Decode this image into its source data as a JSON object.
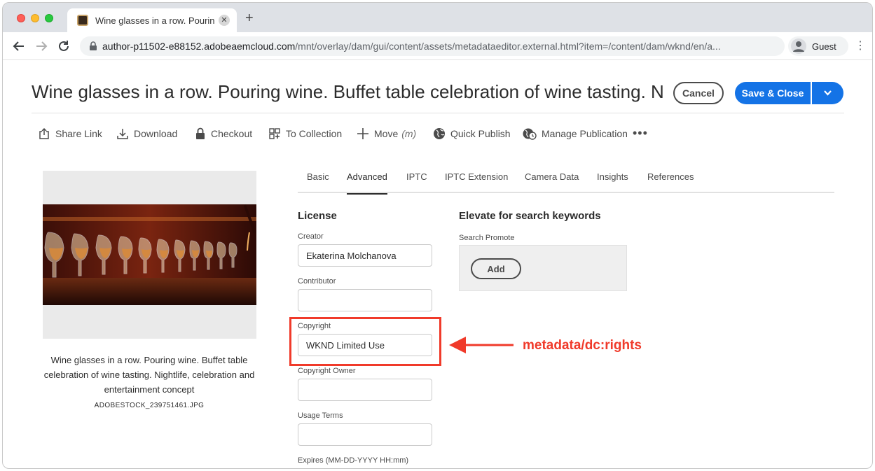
{
  "browser": {
    "tab_title": "Wine glasses in a row. Pouring",
    "url_host": "author-p11502-e88152.adobeaemcloud.com",
    "url_path": "/mnt/overlay/dam/gui/content/assets/metadataeditor.external.html?item=/content/dam/wknd/en/a...",
    "profile_label": "Guest"
  },
  "header": {
    "title": "Wine glasses in a row. Pouring wine. Buffet table celebration of wine tasting. Nightlife, celebration and entertainment concept",
    "cancel_label": "Cancel",
    "save_label": "Save & Close"
  },
  "actions": {
    "share_link": "Share Link",
    "download": "Download",
    "checkout": "Checkout",
    "to_collection": "To Collection",
    "move": "Move",
    "move_shortcut": "(m)",
    "quick_publish": "Quick Publish",
    "manage_publication": "Manage Publication",
    "more": "•••"
  },
  "asset": {
    "caption": "Wine glasses in a row. Pouring wine. Buffet table celebration of wine tasting. Nightlife, celebration and entertainment concept",
    "filename": "ADOBESTOCK_239751461.JPG"
  },
  "tabs": {
    "basic": "Basic",
    "advanced": "Advanced",
    "iptc": "IPTC",
    "iptc_extension": "IPTC Extension",
    "camera_data": "Camera Data",
    "insights": "Insights",
    "references": "References"
  },
  "license": {
    "heading": "License",
    "creator_label": "Creator",
    "creator_value": "Ekaterina Molchanova",
    "contributor_label": "Contributor",
    "contributor_value": "",
    "copyright_label": "Copyright",
    "copyright_value": "WKND Limited Use",
    "copyright_owner_label": "Copyright Owner",
    "copyright_owner_value": "",
    "usage_terms_label": "Usage Terms",
    "usage_terms_value": "",
    "expires_label": "Expires (MM-DD-YYYY HH:mm)"
  },
  "search": {
    "heading": "Elevate for search keywords",
    "promote_label": "Search Promote",
    "add_label": "Add"
  },
  "annotation": {
    "text": "metadata/dc:rights",
    "color": "#f03a2a"
  },
  "colors": {
    "primary": "#1473e6"
  }
}
